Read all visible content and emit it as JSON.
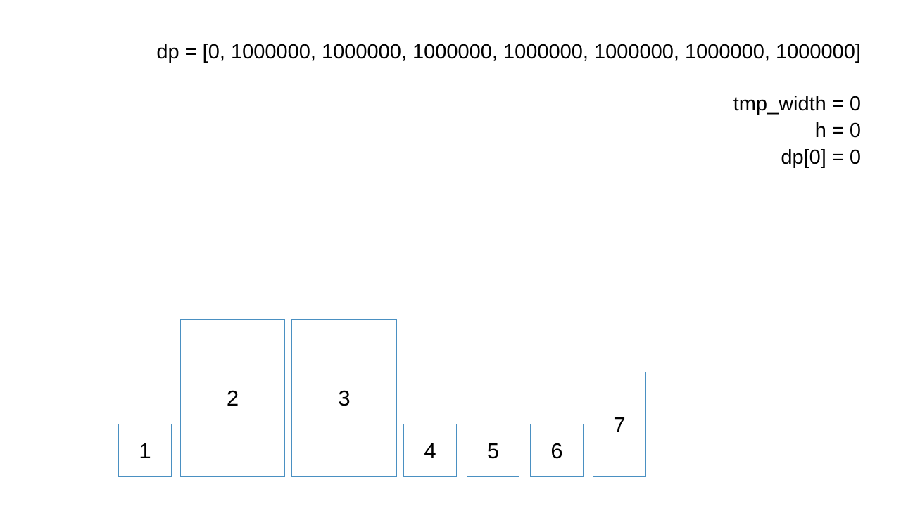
{
  "dp_line": "dp = [0, 1000000, 1000000, 1000000, 1000000, 1000000, 1000000, 1000000]",
  "variables": [
    "tmp_width = 0",
    "h = 0",
    "dp[0] = 0"
  ],
  "boxes": [
    {
      "label": "1"
    },
    {
      "label": "2"
    },
    {
      "label": "3"
    },
    {
      "label": "4"
    },
    {
      "label": "5"
    },
    {
      "label": "6"
    },
    {
      "label": "7"
    }
  ],
  "colors": {
    "box_border": "#4a90c2",
    "text": "#000000",
    "background": "#ffffff"
  }
}
